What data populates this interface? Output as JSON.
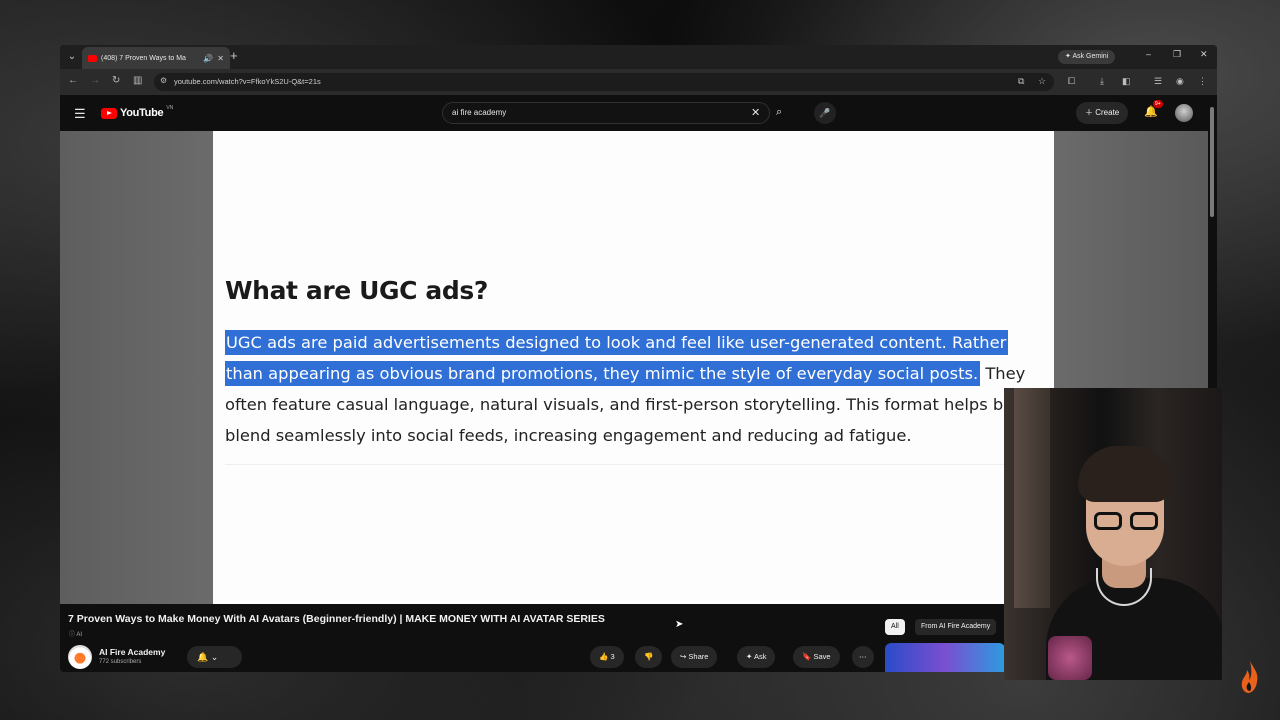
{
  "browser": {
    "tab_title": "(408) 7 Proven Ways to Ma",
    "ask_gemini": "Ask Gemini",
    "url": "youtube.com/watch?v=FfkoYkS2U-Q&t=21s"
  },
  "youtube": {
    "logo_text": "YouTube",
    "country_code": "VN",
    "search_query": "ai fire academy",
    "create_label": "Create",
    "notif_badge": "9+"
  },
  "slide": {
    "heading": "What are UGC ads?",
    "para_line1": "UGC ads are paid advertisements designed to look and feel like user-generated content. Rather",
    "para_line2_hl": "than appearing as obvious brand promotions, they mimic the style of everyday social posts.",
    "para_line2_rest": " They",
    "para_line3": "often feature casual language, natural visuals, and first-person storytelling. This format helps br",
    "para_line4": "blend seamlessly into social feeds, increasing engagement and reducing ad fatigue."
  },
  "video": {
    "title": "7 Proven Ways to Make Money With AI Avatars (Beginner-friendly) | MAKE MONEY WITH AI AVATAR SERIES",
    "ai_label": "AI",
    "channel_name": "AI Fire Academy",
    "subscribers": "772 subscribers",
    "likes": "3",
    "share_label": "Share",
    "ask_label": "Ask",
    "save_label": "Save"
  },
  "filters": {
    "all": "All",
    "from_channel": "From AI Fire Academy"
  },
  "colors": {
    "highlight": "#2f6fd6",
    "yt_red": "#ff0000"
  }
}
